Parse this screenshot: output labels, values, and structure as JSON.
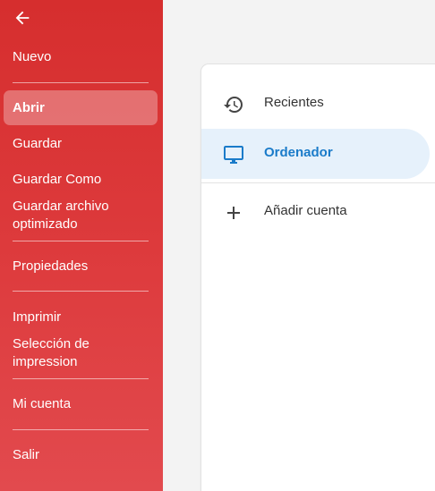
{
  "sidebar": {
    "back_icon": "arrow-left-icon",
    "items": {
      "nuevo": "Nuevo",
      "abrir": "Abrir",
      "guardar": "Guardar",
      "guardar_como": "Guardar Como",
      "guardar_optimizado": "Guardar archivo optimizado",
      "propiedades": "Propiedades",
      "imprimir": "Imprimir",
      "seleccion_impresion": "Selección de impression",
      "mi_cuenta": "Mi cuenta",
      "salir": "Salir"
    },
    "active_item": "Abrir",
    "colors": {
      "background_top": "#d62e2e",
      "background_bottom": "#e24a4e",
      "text": "#ffffff"
    }
  },
  "locations": {
    "recientes": {
      "label": "Recientes",
      "icon": "history-icon"
    },
    "ordenador": {
      "label": "Ordenador",
      "icon": "monitor-icon",
      "selected": true
    },
    "anadir_cuenta": {
      "label": "Añadir cuenta",
      "icon": "plus-icon"
    },
    "colors": {
      "selected_bg": "#e6f1fb",
      "selected_text": "#1a7bc9"
    }
  }
}
